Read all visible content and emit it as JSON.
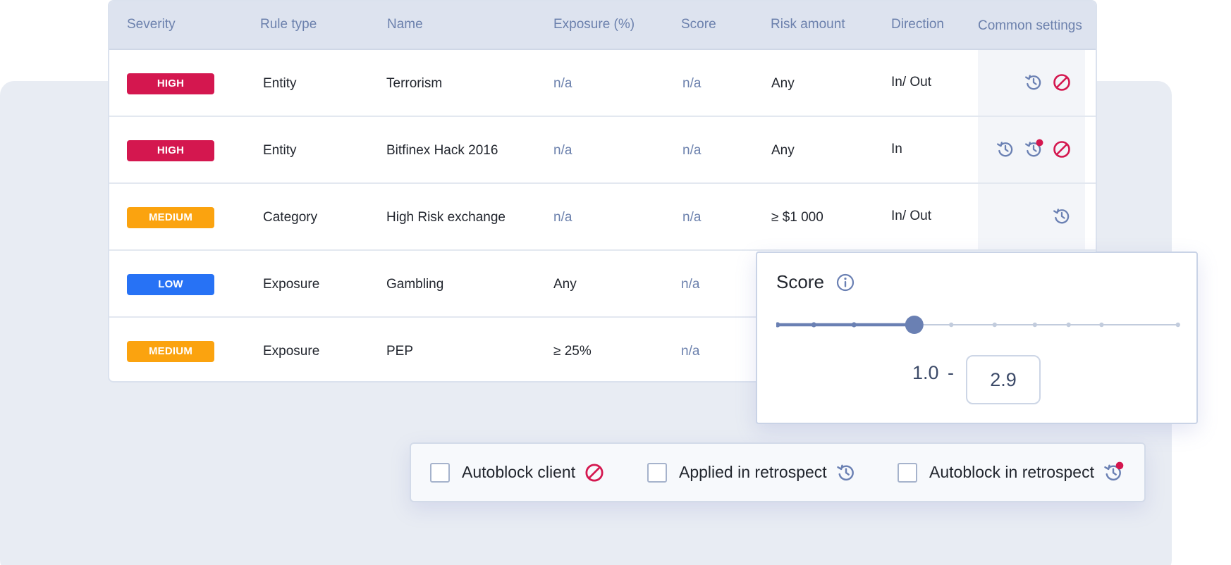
{
  "colors": {
    "high": "#d4174f",
    "medium": "#fba30f",
    "low": "#2772f5",
    "accent": "#6a80b3"
  },
  "table": {
    "headers": [
      "Severity",
      "Rule type",
      "Name",
      "Exposure (%)",
      "Score",
      "Risk amount",
      "Direction",
      "Common settings"
    ],
    "rows": [
      {
        "severity": "HIGH",
        "level": "high",
        "rule_type": "Entity",
        "name": "Terrorism",
        "exposure": "n/a",
        "score": "n/a",
        "risk_amount": "Any",
        "direction": "In/ Out",
        "icons": [
          "history-icon",
          "block-icon"
        ]
      },
      {
        "severity": "HIGH",
        "level": "high",
        "rule_type": "Entity",
        "name": "Bitfinex Hack 2016",
        "exposure": "n/a",
        "score": "n/a",
        "risk_amount": "Any",
        "direction": "In",
        "icons": [
          "history-icon",
          "history-alert-icon",
          "block-icon"
        ]
      },
      {
        "severity": "MEDIUM",
        "level": "medium",
        "rule_type": "Category",
        "name": "High Risk exchange",
        "exposure": "n/a",
        "score": "n/a",
        "risk_amount": "≥ $1 000",
        "direction": "In/ Out",
        "icons": [
          "history-icon"
        ]
      },
      {
        "severity": "LOW",
        "level": "low",
        "rule_type": "Exposure",
        "name": "Gambling",
        "exposure": "Any",
        "score": "n/a"
      },
      {
        "severity": "MEDIUM",
        "level": "medium",
        "rule_type": "Exposure",
        "name": "PEP",
        "exposure": "≥ 25%",
        "score": "n/a"
      }
    ]
  },
  "score_filter": {
    "title": "Score",
    "min_value": "1.0",
    "separator": "-",
    "max_value": "2.9",
    "slider_position": 0.34
  },
  "options": [
    {
      "label": "Autoblock client",
      "icon": "block-icon"
    },
    {
      "label": "Applied in retrospect",
      "icon": "history-icon"
    },
    {
      "label": "Autoblock in retrospect",
      "icon": "history-alert-icon"
    }
  ]
}
